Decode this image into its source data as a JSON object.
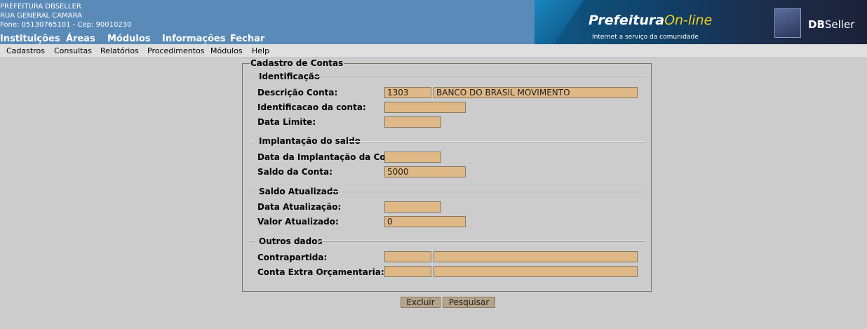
{
  "header": {
    "org_name": "PREFEITURA DBSELLER",
    "address": "RUA GENERAL CAMARA",
    "contact": "Fone: 05130765101  -  Cep: 90010230",
    "top_menu": [
      "Instituições",
      "Áreas",
      "Módulos",
      "Informações",
      "Fechar"
    ],
    "brand_title": "Prefeitura",
    "brand_online": "On-line",
    "brand_subtitle": "Internet a serviço da comunidade",
    "dbseller_db": "DB",
    "dbseller_rest": "Seller"
  },
  "menubar": [
    "Cadastros",
    "Consultas",
    "Relatórios",
    "Procedimentos",
    "Módulos",
    "Help"
  ],
  "form": {
    "legend": "Cadastro de Contas",
    "sections": {
      "identificacao": {
        "title": "Identificação",
        "descricao_label": "Descrição Conta:",
        "descricao_code": "1303",
        "descricao_name": "BANCO DO BRASIL MOVIMENTO",
        "identificacao_label": "Identificacao da conta:",
        "identificacao_value": "",
        "data_limite_label": "Data Limite:",
        "data_limite_value": ""
      },
      "implantacao": {
        "title": "Implantação do saldo",
        "data_label": "Data da Implantação da Conta:",
        "data_value": "",
        "saldo_label": "Saldo da Conta:",
        "saldo_value": "5000"
      },
      "saldo_atualizado": {
        "title": "Saldo Atualizado",
        "data_label": "Data Atualização:",
        "data_value": "",
        "valor_label": "Valor Atualizado:",
        "valor_value": "0"
      },
      "outros": {
        "title": "Outros dados",
        "contrapartida_label": "Contrapartida:",
        "contrapartida_code": "",
        "contrapartida_name": "",
        "extra_label": "Conta Extra Orçamentaria:",
        "extra_code": "",
        "extra_name": ""
      }
    },
    "buttons": {
      "excluir": "Excluir",
      "pesquisar": "Pesquisar"
    }
  },
  "colors": {
    "header_bg": "#5a8ab8",
    "input_bg": "#deb887",
    "page_bg": "#cccccc",
    "online_accent": "#f2d21b"
  }
}
